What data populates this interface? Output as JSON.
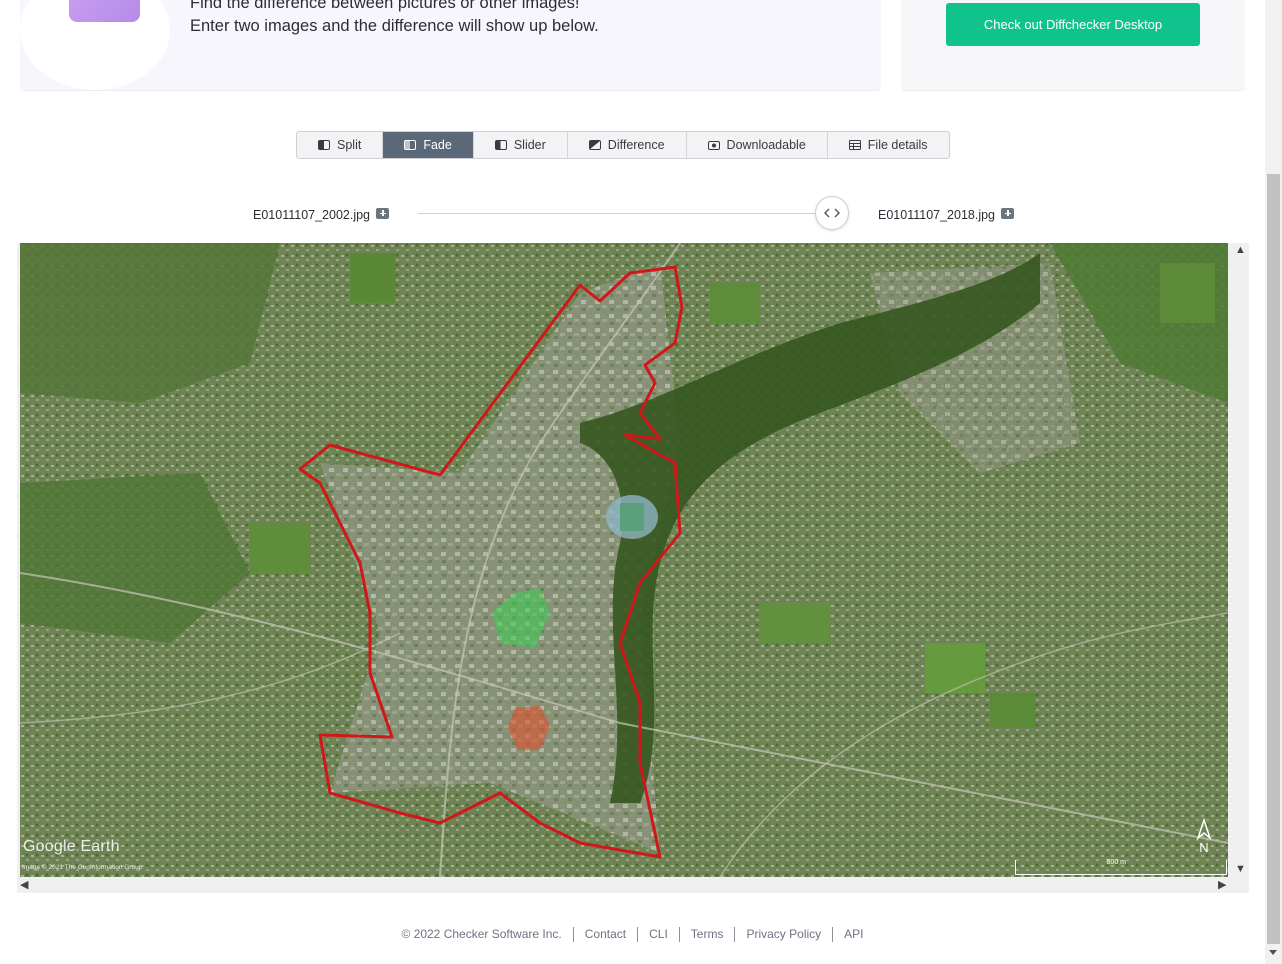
{
  "intro": {
    "line1": "Find the difference between pictures or other images!",
    "line2": "Enter two images and the difference will show up below."
  },
  "promo": {
    "button_label": "Check out Diffchecker Desktop"
  },
  "tabs": [
    {
      "label": "Split",
      "icon": "split-icon",
      "active": false
    },
    {
      "label": "Fade",
      "icon": "fade-icon",
      "active": true
    },
    {
      "label": "Slider",
      "icon": "slider-icon",
      "active": false
    },
    {
      "label": "Difference",
      "icon": "difference-icon",
      "active": false
    },
    {
      "label": "Downloadable",
      "icon": "camera-icon",
      "active": false
    },
    {
      "label": "File details",
      "icon": "table-icon",
      "active": false
    }
  ],
  "files": {
    "left": "E01011107_2002.jpg",
    "right": "E01011107_2018.jpg"
  },
  "fade": {
    "value": 1.0
  },
  "map": {
    "logo": "Google Earth",
    "credit": "Image © 2021 The GeoInformation Group",
    "scale": "800 m",
    "north": "N"
  },
  "footer": {
    "copyright": "© 2022 Checker Software Inc.",
    "links": [
      "Contact",
      "CLI",
      "Terms",
      "Privacy Policy",
      "API"
    ]
  },
  "colors": {
    "accent_green": "#10c38c",
    "tab_active": "#5a6877",
    "boundary_red": "#d0181b"
  }
}
